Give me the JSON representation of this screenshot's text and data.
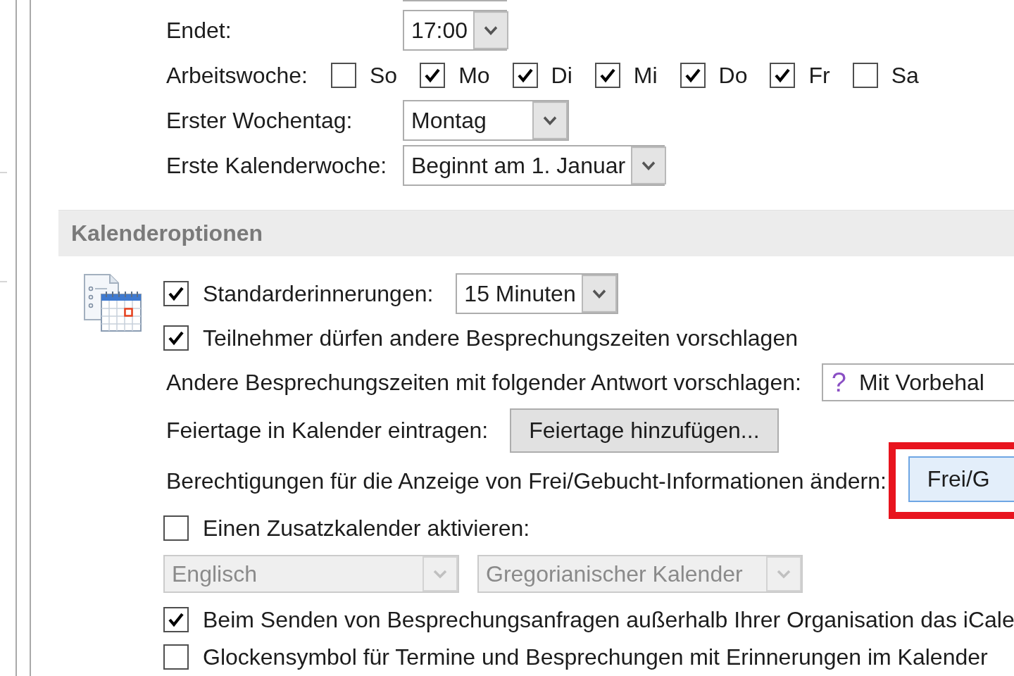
{
  "work_time": {
    "rows": [
      {
        "kind": "dropdown",
        "label": "Endet:",
        "value": "17:00"
      },
      {
        "kind": "weekdays",
        "label": "Arbeitswoche:",
        "days": [
          {
            "label": "So",
            "checked": false
          },
          {
            "label": "Mo",
            "checked": true
          },
          {
            "label": "Di",
            "checked": true
          },
          {
            "label": "Mi",
            "checked": true
          },
          {
            "label": "Do",
            "checked": true
          },
          {
            "label": "Fr",
            "checked": true
          },
          {
            "label": "Sa",
            "checked": false
          }
        ]
      },
      {
        "kind": "dropdown",
        "label": "Erster Wochentag:",
        "value": "Montag"
      },
      {
        "kind": "dropdown",
        "label": "Erste Kalenderwoche:",
        "value": "Beginnt am 1. Januar"
      }
    ]
  },
  "calendar_options": {
    "title": "Kalenderoptionen",
    "rows": [
      {
        "kind": "checkbox_dropdown",
        "label": "Standarderinnerungen:",
        "checked": true,
        "value": "15 Minuten"
      },
      {
        "kind": "checkbox",
        "label": "Teilnehmer dürfen andere Besprechungszeiten vorschlagen",
        "checked": true
      },
      {
        "kind": "label_dropdown",
        "label": "Andere Besprechungszeiten mit folgender Antwort vorschlagen:",
        "icon": "?",
        "value": "Mit Vorbehal"
      },
      {
        "kind": "label_button",
        "label": "Feiertage in Kalender eintragen:",
        "button": "Feiertage hinzufügen...",
        "highlighted": false
      },
      {
        "kind": "label_button",
        "label": "Berechtigungen für die Anzeige von Frei/Gebucht-Informationen ändern:",
        "button": "Frei/G",
        "highlighted": true
      },
      {
        "kind": "checkbox",
        "label": "Einen Zusatzkalender aktivieren:",
        "checked": false
      },
      {
        "kind": "dropdown_pair",
        "dropdowns": [
          {
            "value": "Englisch",
            "disabled": true
          },
          {
            "value": "Gregorianischer Kalender",
            "disabled": true
          }
        ]
      },
      {
        "kind": "checkbox",
        "label": "Beim Senden von Besprechungsanfragen außerhalb Ihrer Organisation das iCale",
        "checked": true
      },
      {
        "kind": "checkbox",
        "label": "Glockensymbol für Termine und Besprechungen mit Erinnerungen im Kalender",
        "checked": false
      }
    ]
  }
}
